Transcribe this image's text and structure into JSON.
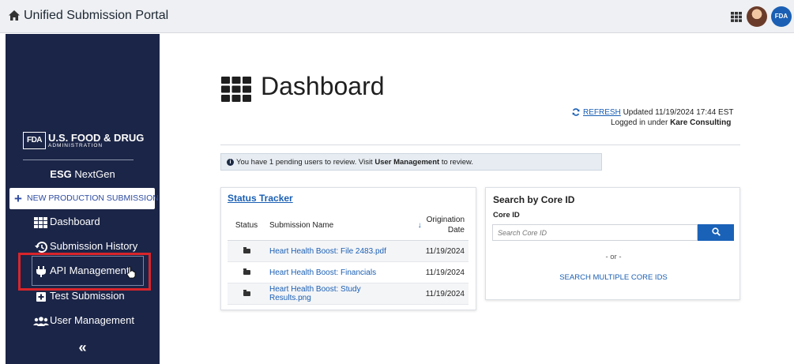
{
  "app": {
    "title": "Unified Submission Portal",
    "header_badge": "FDA"
  },
  "sidebar": {
    "org_short": "FDA",
    "org_name": "U.S. FOOD & DRUG",
    "org_sub": "ADMINISTRATION",
    "product_bold": "ESG",
    "product_rest": " NextGen",
    "new_submission": "NEW PRODUCTION SUBMISSION",
    "items": [
      {
        "label": "Dashboard",
        "icon": "grid-icon"
      },
      {
        "label": "Submission History",
        "icon": "history-icon"
      },
      {
        "label": "API Management",
        "icon": "plug-icon"
      },
      {
        "label": "Test Submission",
        "icon": "plus-square-icon"
      },
      {
        "label": "User Management",
        "icon": "users-icon"
      }
    ],
    "collapse": "«"
  },
  "main": {
    "title": "Dashboard",
    "refresh_label": "REFRESH",
    "updated": "Updated 11/19/2024 17:44 EST",
    "logged_prefix": "Logged in under ",
    "logged_org": "Kare Consulting",
    "alert": {
      "prefix": "You have 1 pending users to review. Visit ",
      "link": "User Management",
      "suffix": " to review."
    }
  },
  "tracker": {
    "title": "Status Tracker",
    "headers": {
      "status": "Status",
      "name": "Submission Name",
      "date_line1": "Origination",
      "date_line2": "Date"
    },
    "rows": [
      {
        "name": "Heart Health Boost: File 2483.pdf",
        "date": "11/19/2024"
      },
      {
        "name": "Heart Health Boost: Financials",
        "date": "11/19/2024"
      },
      {
        "name": "Heart Health Boost: Study Results.png",
        "date": "11/19/2024"
      }
    ]
  },
  "search": {
    "title": "Search by Core ID",
    "label": "Core ID",
    "placeholder": "Search Core ID",
    "or": "- or -",
    "multi": "SEARCH MULTIPLE CORE IDS"
  },
  "colors": {
    "sidebar": "#1b2547",
    "accent": "#1a5fb4",
    "highlight": "#d9252b"
  }
}
